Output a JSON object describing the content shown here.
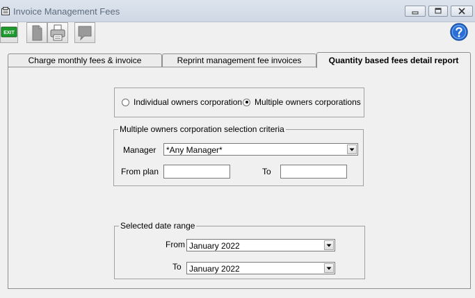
{
  "window": {
    "title": "Invoice Management Fees"
  },
  "tabs": [
    {
      "label": "Charge monthly fees & invoice"
    },
    {
      "label": "Reprint management fee invoices"
    },
    {
      "label": "Quantity based fees detail report",
      "active": true
    }
  ],
  "scope": {
    "options": [
      {
        "label": "Individual owners corporation",
        "selected": false
      },
      {
        "label": "Multiple owners corporations",
        "selected": true
      }
    ]
  },
  "criteria": {
    "legend": "Multiple owners corporation selection criteria",
    "manager_label": "Manager",
    "manager_value": "*Any Manager*",
    "from_plan_label": "From plan",
    "from_plan_value": "",
    "to_label": "To",
    "to_value": ""
  },
  "date_range": {
    "legend": "Selected date range",
    "from_label": "From",
    "from_value": "January 2022",
    "to_label": "To",
    "to_value": "January 2022"
  },
  "toolbar": {
    "exit_label": "EXIT"
  },
  "colors": {
    "exit_green": "#1e9b2d",
    "help_blue": "#2a6fd6"
  },
  "icons": [
    "app-icon",
    "minimize-icon",
    "maximize-icon",
    "close-icon",
    "exit-icon",
    "document-icon",
    "printer-icon",
    "comment-icon",
    "help-icon",
    "dropdown-arrow-icon"
  ]
}
